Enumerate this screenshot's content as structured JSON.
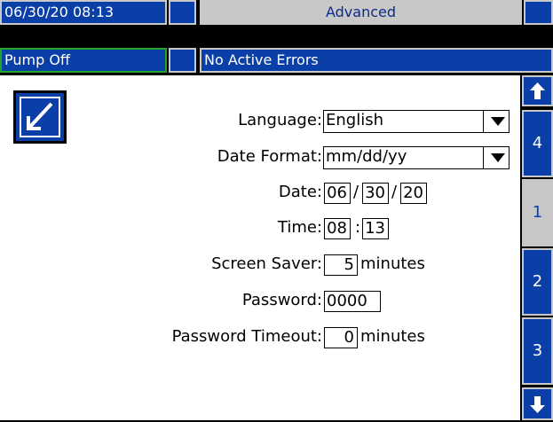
{
  "header": {
    "datetime": "06/30/20 08:13",
    "screen_title": "Advanced",
    "pump_status": "Pump Off",
    "errors": "No Active Errors"
  },
  "form": {
    "language": {
      "label": "Language:",
      "value": "English"
    },
    "date_format": {
      "label": "Date Format:",
      "value": "mm/dd/yy"
    },
    "date": {
      "label": "Date:",
      "month": "06",
      "day": "30",
      "year": "20",
      "sep": "/"
    },
    "time": {
      "label": "Time:",
      "hour": "08",
      "minute": "13",
      "sep": ":"
    },
    "screen_saver": {
      "label": "Screen Saver:",
      "value": "5",
      "unit": "minutes"
    },
    "password": {
      "label": "Password:",
      "value": "0000"
    },
    "password_timeout": {
      "label": "Password Timeout:",
      "value": "0",
      "unit": "minutes"
    }
  },
  "side_nav": {
    "tabs": [
      {
        "label": "4"
      },
      {
        "label": "1"
      },
      {
        "label": "2"
      },
      {
        "label": "3"
      }
    ],
    "active_tab": "1"
  },
  "colors": {
    "blue": "#0a3fa8",
    "gray": "#c8c8c8",
    "pump_border": "#1fa52a"
  },
  "icons": [
    "edit-icon",
    "up-arrow-icon",
    "down-arrow-icon",
    "dropdown-arrow-icon"
  ]
}
